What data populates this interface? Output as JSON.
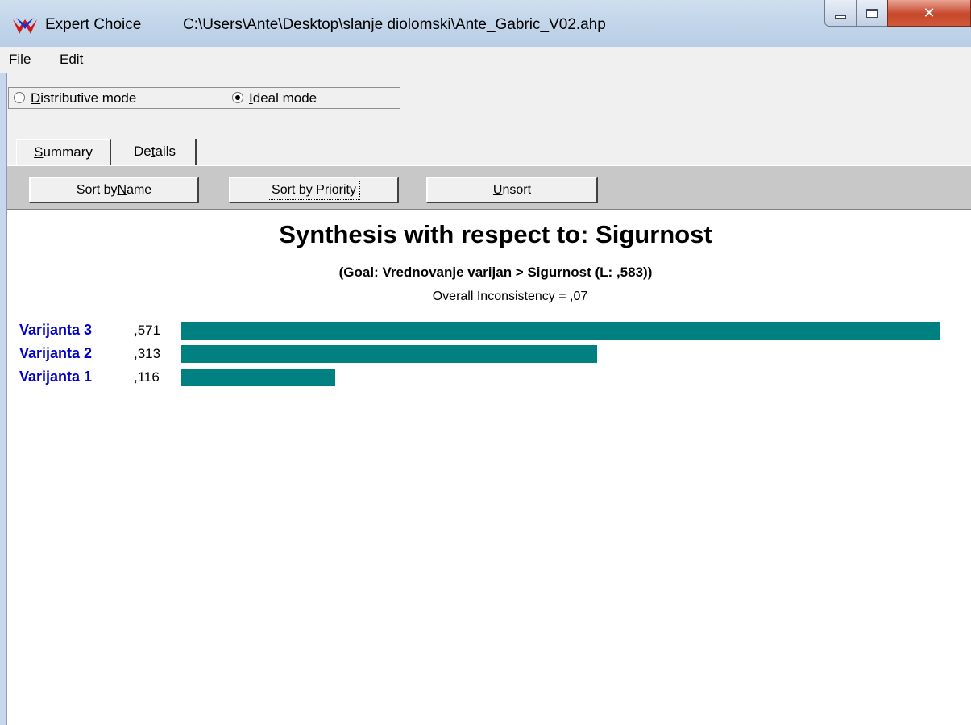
{
  "window": {
    "app_name": "Expert Choice",
    "file_path": "C:\\Users\\Ante\\Desktop\\slanje diolomski\\Ante_Gabric_V02.ahp",
    "logo_icon": "expert-choice-logo",
    "controls": [
      "minimize-icon",
      "maximize-icon",
      "close-icon"
    ]
  },
  "menu": {
    "file": "File",
    "edit": "Edit"
  },
  "modes": {
    "distributive": "Distributive mode",
    "ideal": "Ideal mode",
    "selected": "ideal"
  },
  "tabs": {
    "summary": "Summary",
    "details": "Details",
    "active": "summary"
  },
  "toolbar": {
    "sort_name": "Sort by Name",
    "sort_priority": "Sort by Priority",
    "unsort": "Unsort"
  },
  "synthesis": {
    "title": "Synthesis with respect to: Sigurnost",
    "goal": "(Goal: Vrednovanje varijan > Sigurnost (L: ,583))",
    "inconsistency": "Overall Inconsistency = ,07",
    "bar_color": "#008080",
    "name_color": "#0000cc"
  },
  "chart_data": {
    "type": "bar",
    "categories": [
      "Varijanta 3",
      "Varijanta 2",
      "Varijanta 1"
    ],
    "labels": [
      ",571",
      ",313",
      ",116"
    ],
    "values": [
      0.571,
      0.313,
      0.116
    ]
  }
}
